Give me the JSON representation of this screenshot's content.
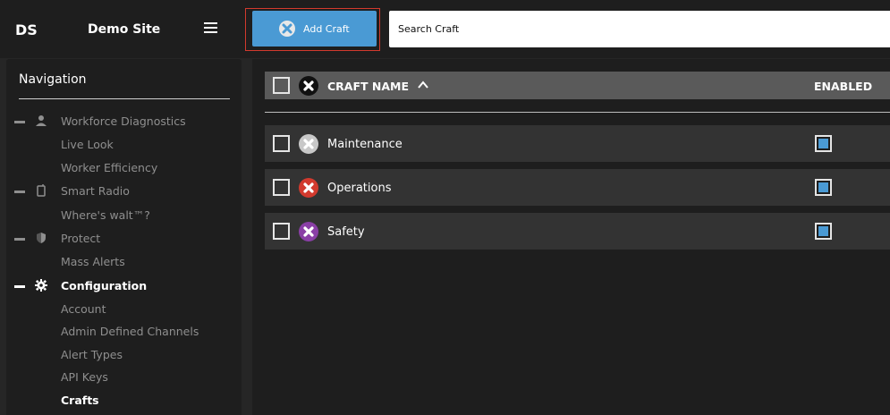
{
  "header": {
    "site_abbr": "DS",
    "site_name": "Demo Site",
    "add_button_label": "Add Craft",
    "search_placeholder": "Search Craft"
  },
  "sidebar": {
    "title": "Navigation",
    "items": [
      {
        "label": "Workforce Diagnostics",
        "icon": "person-icon",
        "section": true,
        "active": false
      },
      {
        "label": "Live Look",
        "section": false,
        "active": false
      },
      {
        "label": "Worker Efficiency",
        "section": false,
        "active": false
      },
      {
        "label": "Smart Radio",
        "icon": "radio-icon",
        "section": true,
        "active": false
      },
      {
        "label": "Where's walt™?",
        "section": false,
        "active": false
      },
      {
        "label": "Protect",
        "icon": "shield-icon",
        "section": true,
        "active": false
      },
      {
        "label": "Mass Alerts",
        "section": false,
        "active": false
      },
      {
        "label": "Configuration",
        "icon": "gear-icon",
        "section": true,
        "active": true
      },
      {
        "label": "Account",
        "section": false,
        "active": false
      },
      {
        "label": "Admin Defined Channels",
        "section": false,
        "active": false
      },
      {
        "label": "Alert Types",
        "section": false,
        "active": false
      },
      {
        "label": "API Keys",
        "section": false,
        "active": false
      },
      {
        "label": "Crafts",
        "section": false,
        "active": true
      }
    ]
  },
  "table": {
    "columns": {
      "name": "CRAFT NAME",
      "enabled": "ENABLED"
    },
    "sort": "ascending",
    "rows": [
      {
        "name": "Maintenance",
        "icon_color": "#c8c8c8",
        "enabled": true
      },
      {
        "name": "Operations",
        "icon_color": "#d23a2e",
        "enabled": true
      },
      {
        "name": "Safety",
        "icon_color": "#8a3fa6",
        "enabled": true
      }
    ]
  },
  "colors": {
    "accent": "#4a9ad4",
    "highlight_border": "#d23a2e"
  }
}
